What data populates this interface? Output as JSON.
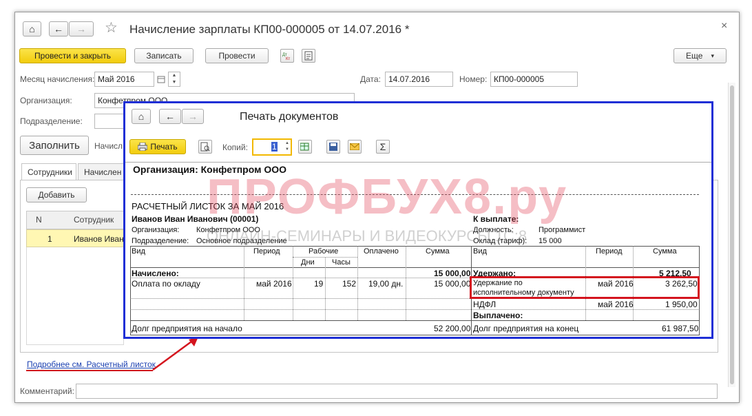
{
  "window": {
    "title": "Начисление зарплаты КП00-000005 от 14.07.2016 *",
    "close_glyph": "×",
    "nav": {
      "home": "⌂",
      "back": "←",
      "forward": "→",
      "star": "☆"
    }
  },
  "toolbar": {
    "post_close": "Провести и закрыть",
    "save": "Записать",
    "post": "Провести",
    "more": "Еще",
    "more_arrow": "▾"
  },
  "form": {
    "month_label": "Месяц начисления:",
    "month_value": "Май 2016",
    "date_label": "Дата:",
    "date_value": "14.07.2016",
    "number_label": "Номер:",
    "number_value": "КП00-000005",
    "org_label": "Организация:",
    "org_value": "Конфетпром ООО",
    "dept_label": "Подразделение:",
    "fill_button": "Заполнить",
    "accrued_partial": "Начисл",
    "comment_label": "Комментарий:"
  },
  "tabs": [
    {
      "label": "Сотрудники"
    },
    {
      "label": "Начислен"
    }
  ],
  "employees": {
    "add_button": "Добавить",
    "columns": [
      "N",
      "Сотрудник"
    ],
    "rows": [
      {
        "n": "1",
        "name": "Иванов Иван"
      }
    ],
    "link": "Подробнее см. Расчетный листок"
  },
  "print_window": {
    "title": "Печать документов",
    "print_button": "Печать",
    "copies_label": "Копий:",
    "copies_value": "1",
    "sum_glyph": "Σ"
  },
  "payslip": {
    "org_header": "Организация: Конфетпром ООО",
    "title": "РАСЧЕТНЫЙ ЛИСТОК ЗА МАЙ 2016",
    "employee": "Иванов Иван Иванович (00001)",
    "org_label": "Организация:",
    "org_value": "Конфетпром ООО",
    "dept_label": "Подразделение:",
    "dept_value": "Основное подразделение",
    "to_pay_label": "К выплате:",
    "position_label": "Должность:",
    "position_value": "Программист",
    "salary_label": "Оклад (тариф):",
    "salary_value": "15 000",
    "headers": {
      "vid": "Вид",
      "period": "Период",
      "working": "Рабочие",
      "days": "Дни",
      "hours": "Часы",
      "paid": "Оплачено",
      "sum": "Сумма",
      "vid2": "Вид",
      "period2": "Период",
      "sum2": "Сумма"
    },
    "accrued_label": "Начислено:",
    "accrued_total": "15 000,00",
    "withheld_label": "Удержано:",
    "withheld_total": "5 212,50",
    "accrual_row": {
      "vid": "Оплата по окладу",
      "period": "май 2016",
      "days": "19",
      "hours": "152",
      "paid": "19,00 дн.",
      "sum": "15 000,00"
    },
    "withhold_row1": {
      "vid_line1": "Удержание по",
      "vid_line2": "исполнительному документу",
      "period": "май 2016",
      "sum": "3 262,50"
    },
    "withhold_row2": {
      "vid": "НДФЛ",
      "period": "май 2016",
      "sum": "1 950,00"
    },
    "paid_label": "Выплачено:",
    "debt_start_label": "Долг предприятия на начало",
    "debt_start_value": "52 200,00",
    "debt_end_label": "Долг предприятия на конец",
    "debt_end_value": "61 987,50"
  },
  "watermark": {
    "main": "ПРОФБУХ8.ру",
    "sub": "ОНЛАЙН-СЕМИНАРЫ И ВИДЕОКУРСЫ 1С:8"
  },
  "colors": {
    "highlight_red": "#d4141e",
    "overlay_border": "#1f2fd6",
    "primary_button": "#f5d322",
    "selected_row": "#fff7b3"
  }
}
